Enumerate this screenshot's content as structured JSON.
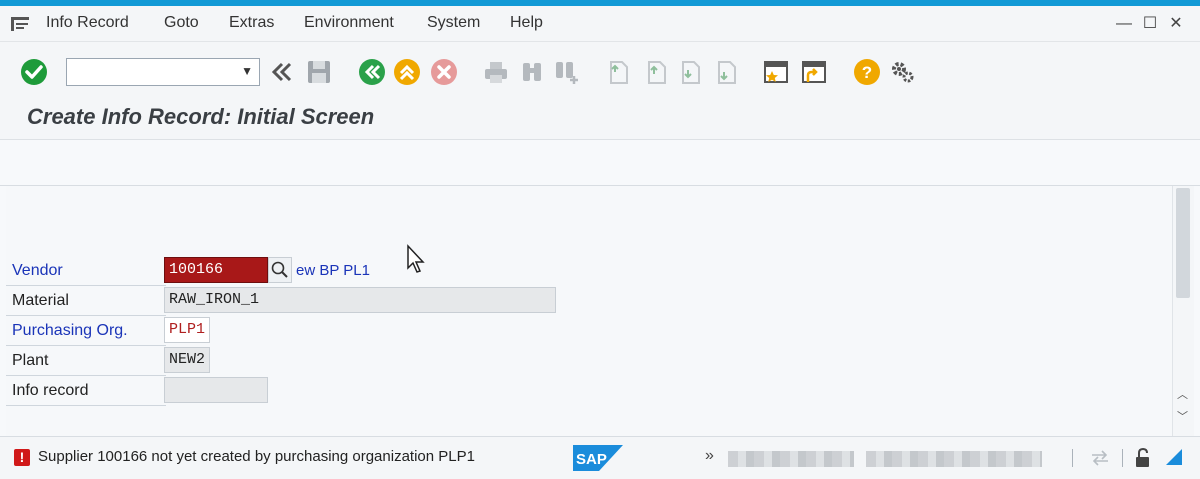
{
  "menu": {
    "items": [
      "Info Record",
      "Goto",
      "Extras",
      "Environment",
      "System",
      "Help"
    ]
  },
  "window_controls": {
    "minimize": "—",
    "maximize": "☐",
    "close": "✕"
  },
  "toolbar": {
    "command_field_value": "",
    "icons": [
      "enter-icon",
      "back-chevron-icon",
      "save-icon",
      "back-icon",
      "exit-icon",
      "cancel-icon",
      "print-icon",
      "find-icon",
      "find-next-icon",
      "first-page-icon",
      "previous-page-icon",
      "next-page-icon",
      "last-page-icon",
      "create-session-icon",
      "shortcut-icon",
      "help-icon",
      "settings-icon"
    ]
  },
  "page": {
    "title": "Create Info Record: Initial Screen"
  },
  "form": {
    "vendor_label": "Vendor",
    "vendor_value": "100166",
    "vendor_desc": "ew BP PL1",
    "material_label": "Material",
    "material_value": "RAW_IRON_1",
    "purch_org_label": "Purchasing Org.",
    "purch_org_value": "PLP1",
    "plant_label": "Plant",
    "plant_value": "NEW2",
    "info_record_label": "Info record",
    "info_record_value": ""
  },
  "status": {
    "type": "error",
    "message": "Supplier 100166 not yet created by purchasing organization PLP1",
    "logo": "SAP",
    "more": "»"
  },
  "colors": {
    "accent": "#129ad6",
    "error": "#a81818",
    "field_label_blue": "#1a34b8",
    "enter_green": "#1e9b3a",
    "nav_green": "#2aa14a",
    "nav_orange": "#f0a800",
    "cancel_red": "#e05050"
  }
}
